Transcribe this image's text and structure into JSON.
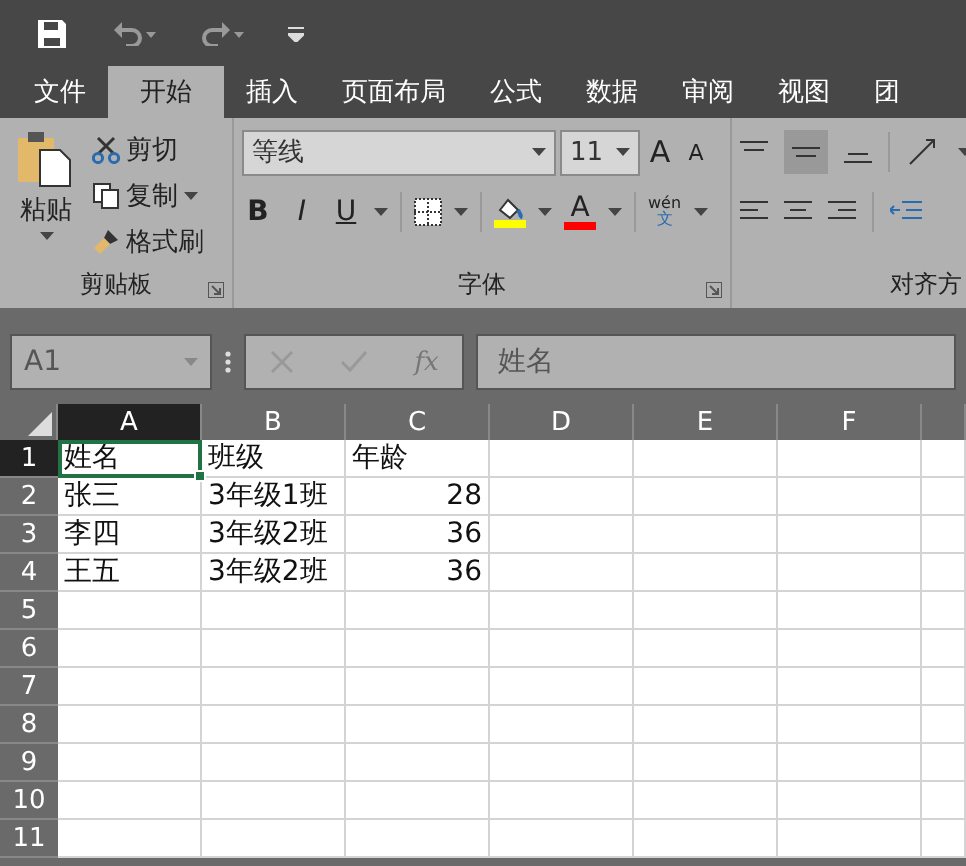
{
  "tabs": [
    {
      "label": "文件",
      "selected": false
    },
    {
      "label": "开始",
      "selected": true
    },
    {
      "label": "插入",
      "selected": false
    },
    {
      "label": "页面布局",
      "selected": false
    },
    {
      "label": "公式",
      "selected": false
    },
    {
      "label": "数据",
      "selected": false
    },
    {
      "label": "审阅",
      "selected": false
    },
    {
      "label": "视图",
      "selected": false
    },
    {
      "label": "团",
      "selected": false
    }
  ],
  "clipboard": {
    "paste": "粘贴",
    "cut": "剪切",
    "copy": "复制",
    "format_painter": "格式刷",
    "group_label": "剪贴板"
  },
  "font": {
    "font_name": "等线",
    "font_size": "11",
    "grow": "A",
    "shrink": "A",
    "bold": "B",
    "italic": "I",
    "underline": "U",
    "font_color": "A",
    "phonetic_top": "wén",
    "phonetic_bottom": "文",
    "group_label": "字体"
  },
  "alignment": {
    "group_label": "对齐方"
  },
  "formula_bar": {
    "name_box": "A1",
    "fx": "fx",
    "value": "姓名"
  },
  "columns": [
    {
      "label": "A",
      "selected": true
    },
    {
      "label": "B",
      "selected": false
    },
    {
      "label": "C",
      "selected": false
    },
    {
      "label": "D",
      "selected": false
    },
    {
      "label": "E",
      "selected": false
    },
    {
      "label": "F",
      "selected": false
    }
  ],
  "rows": [
    {
      "header": "1",
      "selected": true,
      "cells": [
        {
          "text": "姓名",
          "kind": "text",
          "selected": true
        },
        {
          "text": "班级",
          "kind": "text",
          "selected": false
        },
        {
          "text": "年龄",
          "kind": "text",
          "selected": false
        }
      ]
    },
    {
      "header": "2",
      "selected": false,
      "cells": [
        {
          "text": "张三",
          "kind": "text",
          "selected": false
        },
        {
          "text": "3年级1班",
          "kind": "text",
          "selected": false
        },
        {
          "text": "28",
          "kind": "number",
          "selected": false
        }
      ]
    },
    {
      "header": "3",
      "selected": false,
      "cells": [
        {
          "text": "李四",
          "kind": "text",
          "selected": false
        },
        {
          "text": "3年级2班",
          "kind": "text",
          "selected": false
        },
        {
          "text": "36",
          "kind": "number",
          "selected": false
        }
      ]
    },
    {
      "header": "4",
      "selected": false,
      "cells": [
        {
          "text": "王五",
          "kind": "text",
          "selected": false
        },
        {
          "text": "3年级2班",
          "kind": "text",
          "selected": false
        },
        {
          "text": "36",
          "kind": "number",
          "selected": false
        }
      ]
    },
    {
      "header": "5",
      "selected": false,
      "cells": []
    },
    {
      "header": "6",
      "selected": false,
      "cells": []
    },
    {
      "header": "7",
      "selected": false,
      "cells": []
    },
    {
      "header": "8",
      "selected": false,
      "cells": []
    },
    {
      "header": "9",
      "selected": false,
      "cells": []
    },
    {
      "header": "10",
      "selected": false,
      "cells": []
    },
    {
      "header": "11",
      "selected": false,
      "cells": []
    }
  ]
}
